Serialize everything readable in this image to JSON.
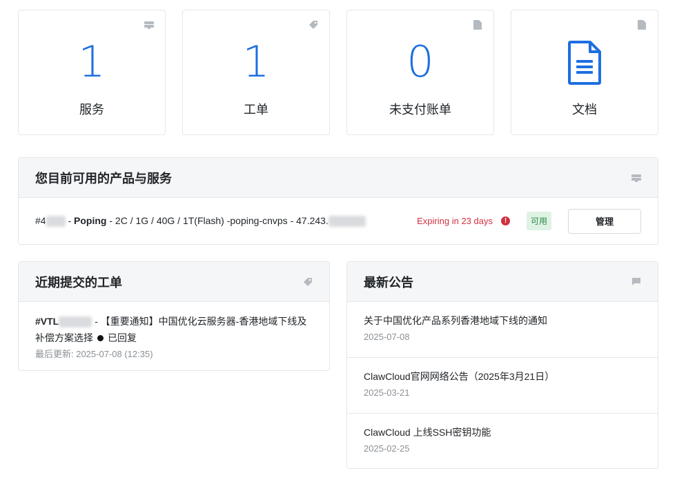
{
  "colors": {
    "accent": "#1d6fe0",
    "danger": "#d3303f",
    "success_bg": "#dff3e4",
    "success_text": "#2a8a45",
    "muted": "#8a9096"
  },
  "tiles": [
    {
      "value": "1",
      "label": "服务",
      "icon": "server-icon"
    },
    {
      "value": "1",
      "label": "工单",
      "icon": "tag-icon"
    },
    {
      "value": "0",
      "label": "未支付账单",
      "icon": "file-icon"
    },
    {
      "label": "文档",
      "icon": "file-text-icon"
    }
  ],
  "services": {
    "title": "您目前可用的产品与服务",
    "item": {
      "id_prefix": "#4",
      "separator": " - ",
      "product": "Poping",
      "details": " - 2C / 1G / 40G / 1T(Flash) -poping-cnvps - 47.243.",
      "expiry": "Expiring in 23 days",
      "status": "可用",
      "manage_label": "管理"
    }
  },
  "tickets": {
    "title": "近期提交的工单",
    "item": {
      "id_prefix": "#VTL",
      "subject": " - 【重要通知】中国优化云服务器-香港地域下线及补偿方案选择",
      "status": "已回复",
      "updated": "最后更新: 2025-07-08 (12:35)"
    }
  },
  "announcements": {
    "title": "最新公告",
    "items": [
      {
        "title": "关于中国优化产品系列香港地域下线的通知",
        "date": "2025-07-08"
      },
      {
        "title": "ClawCloud官网网络公告（2025年3月21日）",
        "date": "2025-03-21"
      },
      {
        "title": "ClawCloud 上线SSH密钥功能",
        "date": "2025-02-25"
      }
    ]
  }
}
